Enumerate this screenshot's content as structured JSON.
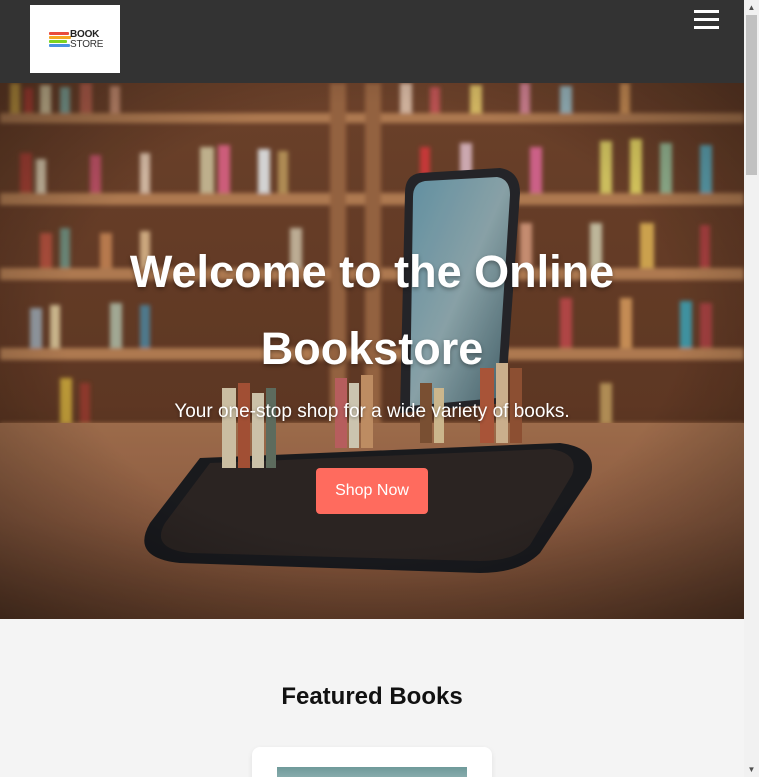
{
  "header": {
    "logo": {
      "line1": "BOOK",
      "line2": "STORE",
      "stripe_colors": [
        "#e94b3c",
        "#f5a623",
        "#7ed321",
        "#4a90e2"
      ]
    },
    "menu_icon": "hamburger-menu-icon",
    "background": "#333333"
  },
  "hero": {
    "title": "Welcome to the Online Bookstore",
    "subtitle": "Your one-stop shop for a wide variety of books.",
    "cta_label": "Shop Now",
    "cta_color": "#ff6b5e"
  },
  "featured": {
    "title": "Featured Books"
  },
  "scrollbar": {
    "up_icon": "scroll-up-arrow-icon",
    "down_icon": "scroll-down-arrow-icon"
  }
}
